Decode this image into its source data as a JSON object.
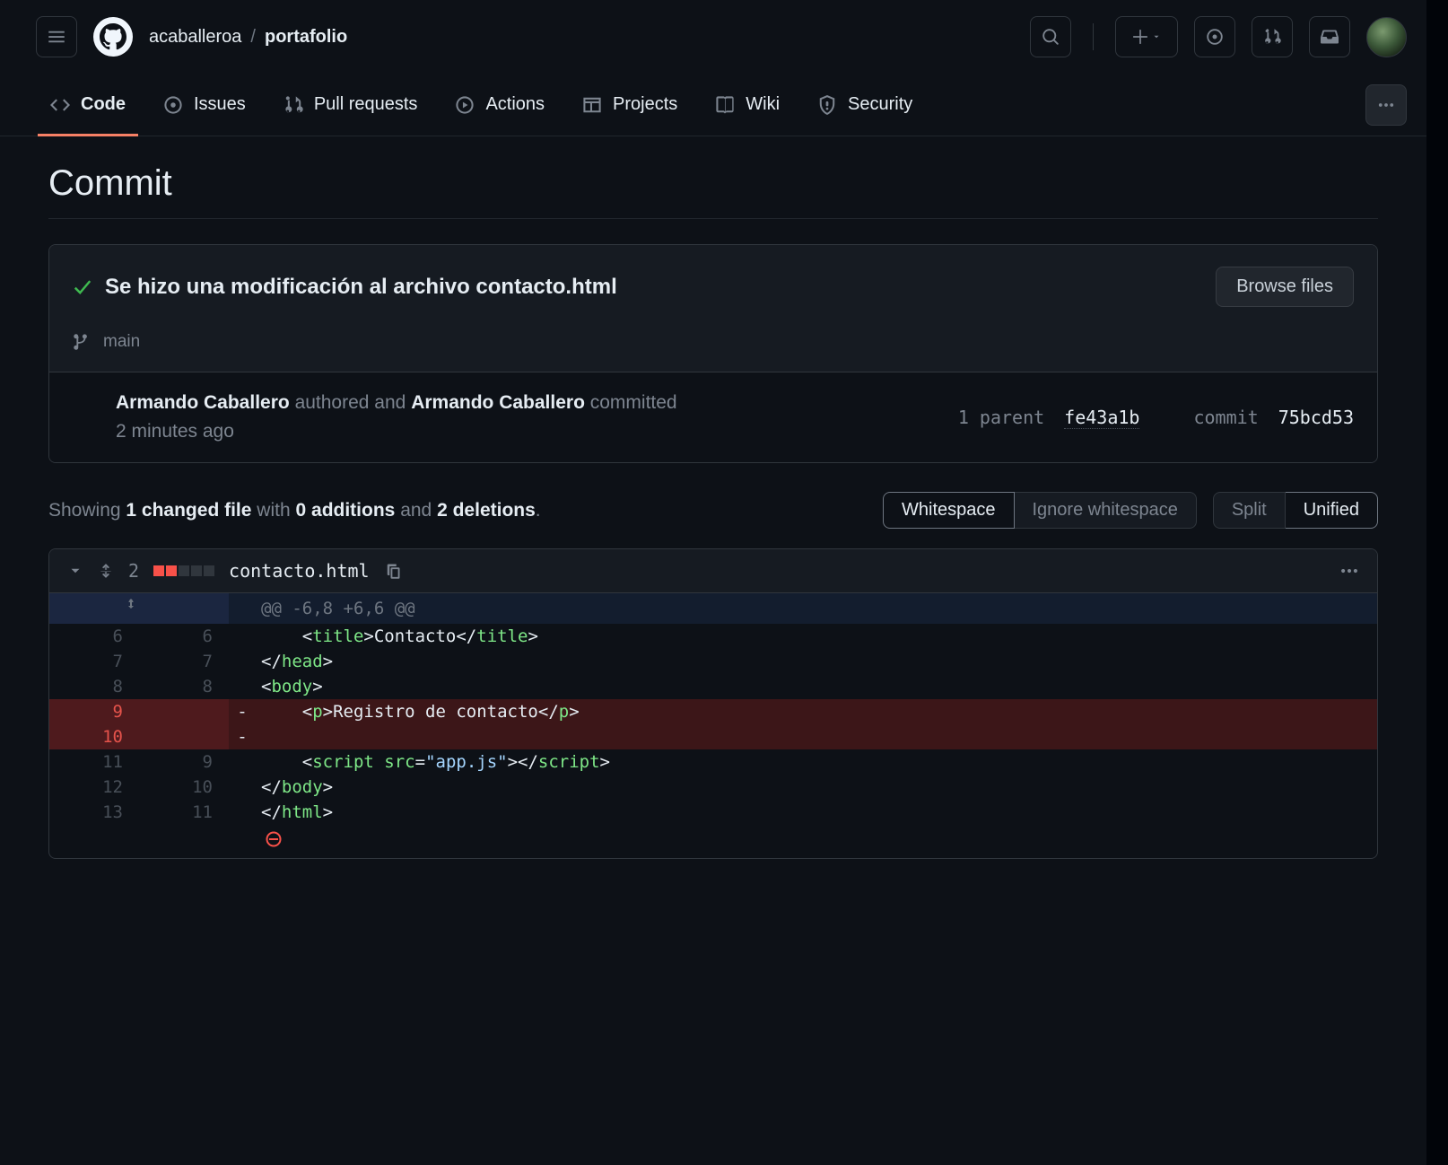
{
  "header": {
    "owner": "acaballeroa",
    "repo": "portafolio"
  },
  "nav": {
    "code": "Code",
    "issues": "Issues",
    "pulls": "Pull requests",
    "actions": "Actions",
    "projects": "Projects",
    "wiki": "Wiki",
    "security": "Security"
  },
  "page_title": "Commit",
  "commit": {
    "title": "Se hizo una modificación al archivo contacto.html",
    "browse_btn": "Browse files",
    "branch": "main",
    "author": "Armando Caballero",
    "authored_word": "authored and",
    "committer": "Armando Caballero",
    "committed_word": "committed",
    "time": "2 minutes ago",
    "parent_label": "1 parent",
    "parent_sha": "fe43a1b",
    "commit_label": "commit",
    "commit_sha": "75bcd53"
  },
  "diffstat": {
    "showing": "Showing",
    "files": "1 changed file",
    "with": "with",
    "additions": "0 additions",
    "and": "and",
    "deletions": "2 deletions",
    "whitespace": "Whitespace",
    "ignore_whitespace": "Ignore whitespace",
    "split": "Split",
    "unified": "Unified"
  },
  "file": {
    "changes": "2",
    "name": "contacto.html",
    "hunk": "@@ -6,8 +6,6 @@"
  },
  "lines": [
    {
      "ol": "6",
      "nl": "6",
      "sign": "",
      "html": "    &lt;<span class='s-tag'>title</span>&gt;Contacto&lt;/<span class='s-tag'>title</span>&gt;"
    },
    {
      "ol": "7",
      "nl": "7",
      "sign": "",
      "html": "&lt;/<span class='s-tag'>head</span>&gt;"
    },
    {
      "ol": "8",
      "nl": "8",
      "sign": "",
      "html": "&lt;<span class='s-tag'>body</span>&gt;"
    },
    {
      "ol": "9",
      "nl": "",
      "sign": "-",
      "type": "del",
      "html": "    &lt;<span class='s-tag'>p</span>&gt;Registro de contacto&lt;/<span class='s-tag'>p</span>&gt;"
    },
    {
      "ol": "10",
      "nl": "",
      "sign": "-",
      "type": "del",
      "html": ""
    },
    {
      "ol": "11",
      "nl": "9",
      "sign": "",
      "html": "    &lt;<span class='s-tag'>script </span><span class='s-attr'>src</span>=<span class='s-str'>\"app.js\"</span>&gt;&lt;/<span class='s-tag'>script</span>&gt;"
    },
    {
      "ol": "12",
      "nl": "10",
      "sign": "",
      "html": "&lt;/<span class='s-tag'>body</span>&gt;"
    },
    {
      "ol": "13",
      "nl": "11",
      "sign": "",
      "html": "&lt;/<span class='s-tag'>html</span>&gt;"
    }
  ]
}
